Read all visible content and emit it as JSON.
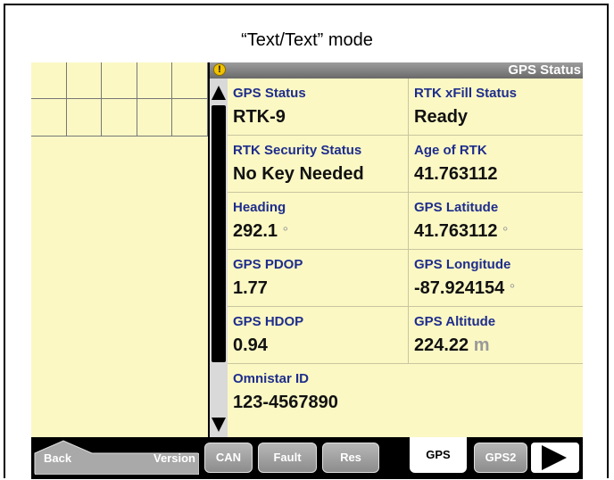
{
  "caption": "“Text/Text” mode",
  "panel": {
    "title": "GPS Status",
    "icon": "warning-icon"
  },
  "cells": [
    {
      "label": "GPS Status",
      "value": "RTK-9",
      "unit": ""
    },
    {
      "label": "RTK xFill Status",
      "value": "Ready",
      "unit": ""
    },
    {
      "label": "RTK Security Status",
      "value": "No Key Needed",
      "unit": ""
    },
    {
      "label": "Age of RTK",
      "value": "41.763112",
      "unit": ""
    },
    {
      "label": "Heading",
      "value": "292.1",
      "unit": "°"
    },
    {
      "label": "GPS Latitude",
      "value": "41.763112",
      "unit": "°"
    },
    {
      "label": "GPS PDOP",
      "value": "1.77",
      "unit": ""
    },
    {
      "label": "GPS Longitude",
      "value": "-87.924154",
      "unit": "°"
    },
    {
      "label": "GPS HDOP",
      "value": "0.94",
      "unit": ""
    },
    {
      "label": "GPS Altitude",
      "value": "224.22",
      "unit": "m"
    },
    {
      "label": "Omnistar ID",
      "value": "123-4567890",
      "unit": ""
    }
  ],
  "tabs": {
    "back": "Back",
    "version": "Version",
    "can": "CAN",
    "fault": "Fault",
    "res": "Res",
    "gps": "GPS",
    "gps2": "GPS2"
  },
  "colors": {
    "panel_bg": "#fbf8c4",
    "label": "#1e2d8c",
    "title_bar": "#7d7d7d"
  }
}
